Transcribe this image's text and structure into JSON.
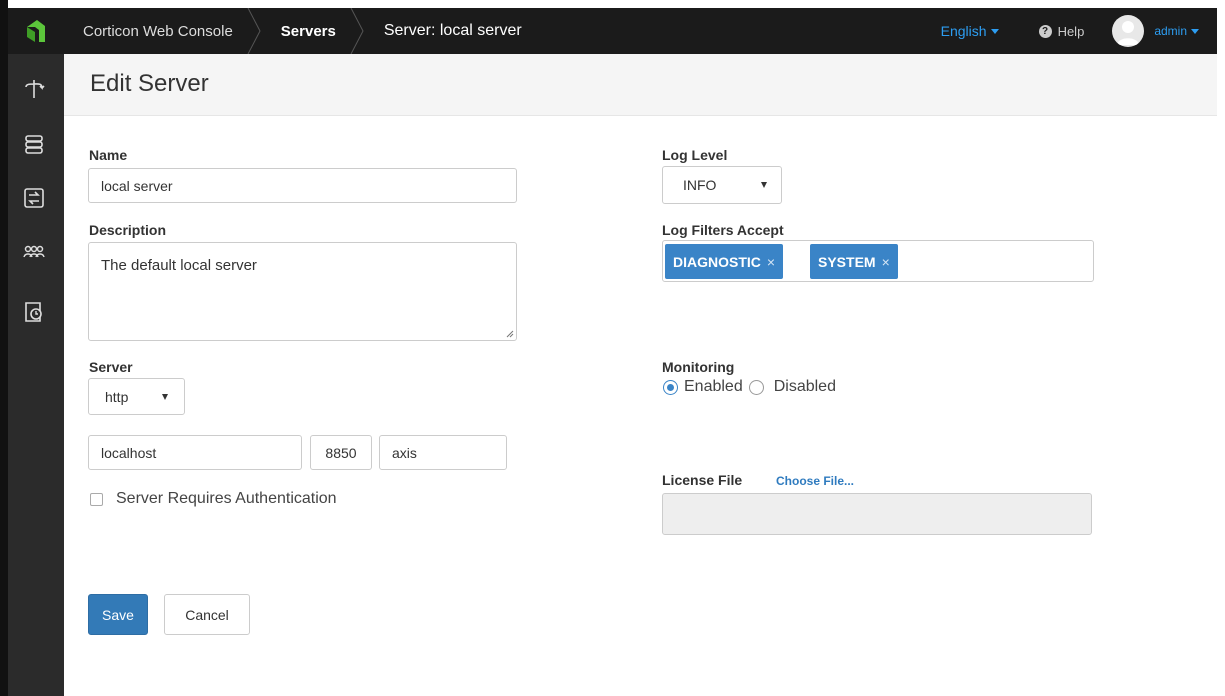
{
  "topbar": {
    "crumbs": [
      "Corticon Web Console",
      "Servers",
      "Server: local server"
    ],
    "language": "English",
    "help": "Help",
    "user": "admin"
  },
  "page": {
    "title": "Edit Server"
  },
  "form": {
    "name_label": "Name",
    "name_value": "local server",
    "description_label": "Description",
    "description_value": "The default local server",
    "server_label": "Server",
    "protocol_value": "http",
    "host_value": "localhost",
    "port_value": "8850",
    "path_value": "axis",
    "auth_label": "Server Requires Authentication",
    "log_level_label": "Log Level",
    "log_level_value": "INFO",
    "log_filters_label": "Log Filters Accept",
    "log_filters": [
      "DIAGNOSTIC",
      "SYSTEM"
    ],
    "tag_remove": "×",
    "monitoring_label": "Monitoring",
    "monitoring_enabled": "Enabled",
    "monitoring_disabled": "Disabled",
    "license_label": "License File",
    "choose_file": "Choose File...",
    "save": "Save",
    "cancel": "Cancel"
  },
  "colors": {
    "accent": "#337ab7",
    "link": "#2d9df1",
    "topbar": "#1b1b1b",
    "sidebar": "#2b2b2b"
  }
}
